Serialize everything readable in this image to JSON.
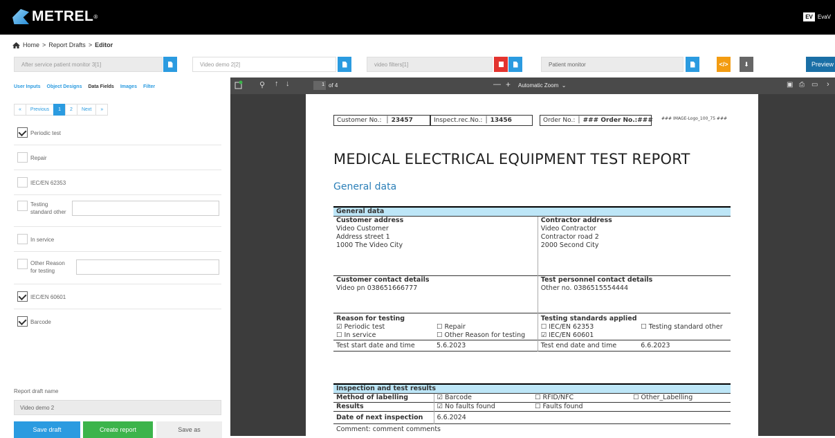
{
  "app": {
    "brand": "METREL",
    "user_initials": "EV",
    "user_name": "EvaV"
  },
  "breadcrumb": {
    "home": "Home",
    "sep": ">",
    "drafts": "Report Drafts",
    "editor": "Editor"
  },
  "drafts": [
    {
      "name": "After service patient monitor 3[1]"
    },
    {
      "name": "Video demo 2[2]"
    },
    {
      "name": "video filters[1]"
    },
    {
      "name": "Patient monitor"
    }
  ],
  "preview_label": "Preview",
  "code_label": "</>",
  "download_label": "⬇",
  "tabs": [
    "User Inputs",
    "Object Designs",
    "Data Fields",
    "Images",
    "Filter"
  ],
  "active_tab": "Data Fields",
  "pager": {
    "first": "«",
    "prev": "Previous",
    "p1": "1",
    "p2": "2",
    "next": "Next",
    "last": "»"
  },
  "fields": {
    "periodic_test": {
      "label": "Periodic test",
      "checked": true
    },
    "repair": {
      "label": "Repair",
      "checked": false
    },
    "iec_62353": {
      "label": "IEC/EN 62353",
      "checked": false
    },
    "testing_standard_other": {
      "label_1": "Testing",
      "label_2": "standard other",
      "checked": false,
      "value": ""
    },
    "in_service": {
      "label": "In service",
      "checked": false
    },
    "other_reason": {
      "label_1": "Other Reason",
      "label_2": "for testing",
      "checked": false,
      "value": ""
    },
    "iec_60601": {
      "label": "IEC/EN 60601",
      "checked": true
    },
    "barcode": {
      "label": "Barcode",
      "checked": true
    }
  },
  "report_draft": {
    "label": "Report draft name",
    "value": "Video demo 2"
  },
  "buttons": {
    "save_draft": "Save draft",
    "create_report": "Create report",
    "save_as": "Save as"
  },
  "viewer": {
    "page": "1",
    "of": "of 4",
    "zoom": "Automatic Zoom",
    "minus": "—",
    "plus": "+"
  },
  "report": {
    "customer_no_label": "Customer No.:",
    "customer_no": "23457",
    "inspect_label": "Inspect.rec.No.:",
    "inspect_no": "13456",
    "order_label": "Order No.:",
    "order_value": "### Order No.:###",
    "logo_placeholder": "### IMAGE-Logo_100_75 ###",
    "title": "MEDICAL ELECTRICAL EQUIPMENT TEST REPORT",
    "section": "General data",
    "gd_bar": "General data",
    "customer_address_h": "Customer address",
    "customer_address": [
      "Video Customer",
      "Address street 1",
      "1000 The Video City"
    ],
    "contractor_address_h": "Contractor address",
    "contractor_address": [
      "Video Contractor",
      "Contractor road 2",
      "2000 Second City"
    ],
    "customer_contact_h": "Customer contact details",
    "customer_contact": "Video pn 038651666777",
    "personnel_contact_h": "Test personnel contact details",
    "personnel_contact": "Other no. 0386515554444",
    "reason_h": "Reason for testing",
    "reason_periodic": "☑ Periodic test",
    "reason_repair": "☐ Repair",
    "reason_inservice": "☐ In service",
    "reason_other": "☐ Other Reason for testing",
    "standards_h": "Testing standards applied",
    "std_62353": "☐ IEC/EN 62353",
    "std_other": "☐ Testing standard other",
    "std_60601": "☑ IEC/EN 60601",
    "start_label": "Test start date and time",
    "start_value": "5.6.2023",
    "end_label": "Test end date and time",
    "end_value": "6.6.2023",
    "itr_bar": "Inspection and test results",
    "method_label": "Method of labelling",
    "method_barcode": "☑ Barcode",
    "method_rfid": "☐ RFID/NFC",
    "method_other": "☐ Other_Labelling",
    "results_label": "Results",
    "results_nofaults": "☑ No faults found",
    "results_faults": "☐ Faults found",
    "next_label": "Date of next inspection",
    "next_value": "6.6.2024",
    "comment": "Comment: comment comments"
  }
}
